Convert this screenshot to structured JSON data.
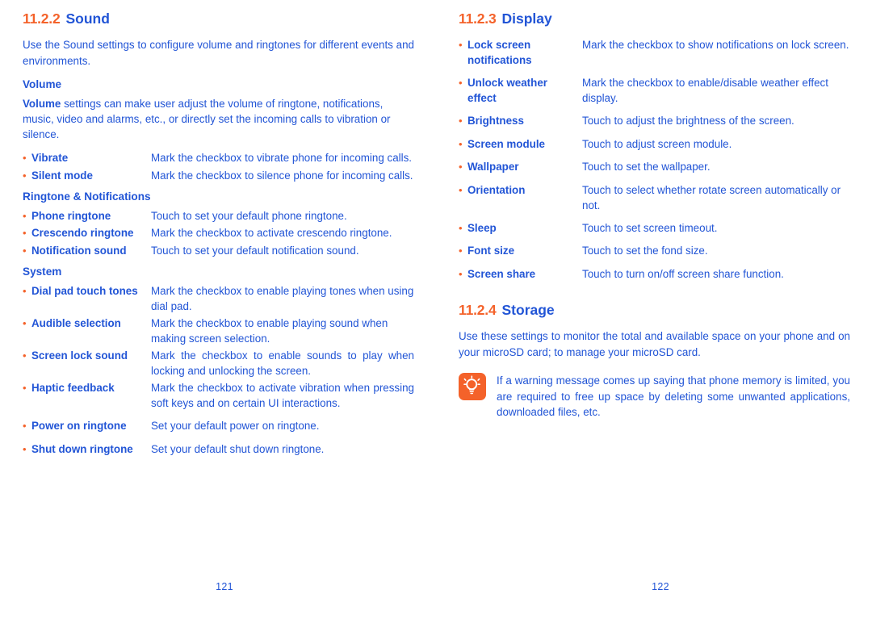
{
  "document": {
    "title": "Settings — Sound, Display, Storage"
  },
  "colors": {
    "accent_orange": "#f4622a",
    "text_blue": "#2255d6",
    "background": "#ffffff"
  },
  "left_page": {
    "page_number": "121",
    "section": {
      "number": "11.2.2",
      "title": "Sound",
      "intro": "Use the Sound settings to configure volume and ringtones for different events  and environments."
    },
    "groups": [
      {
        "heading": "Volume",
        "paragraph_lead": "Volume",
        "paragraph_rest": " settings can make user adjust the volume of ringtone, notifications, music, video and alarms, etc., or directly set the incoming calls to vibration or silence.",
        "items": [
          {
            "term": "Vibrate",
            "desc": "Mark the checkbox to vibrate phone for incoming calls."
          },
          {
            "term": "Silent mode",
            "desc": "Mark the checkbox to silence phone for incoming calls."
          }
        ]
      },
      {
        "heading": "Ringtone & Notifications",
        "items": [
          {
            "term": "Phone ringtone",
            "desc": "Touch to set your default phone ringtone."
          },
          {
            "term": "Crescendo ringtone",
            "desc": "Mark the checkbox to activate crescendo ringtone."
          },
          {
            "term": "Notification sound",
            "desc": "Touch to set your default notification sound."
          }
        ]
      },
      {
        "heading": "System",
        "items": [
          {
            "term": "Dial pad touch tones",
            "desc": "Mark the checkbox to enable playing tones when using dial pad."
          },
          {
            "term": "Audible selection",
            "desc": "Mark the checkbox to enable playing sound when making screen selection."
          },
          {
            "term": "Screen lock sound",
            "desc": "Mark the checkbox to enable sounds to play when locking and unlocking the screen."
          },
          {
            "term": "Haptic feedback",
            "desc": "Mark the checkbox to activate vibration when pressing soft keys and on certain UI interactions."
          },
          {
            "term": "Power on ringtone",
            "desc": "Set your default power on ringtone."
          },
          {
            "term": "Shut down ringtone",
            "desc": "Set your default shut down ringtone."
          }
        ]
      }
    ]
  },
  "right_page": {
    "page_number": "122",
    "display_section": {
      "number": "11.2.3",
      "title": "Display",
      "items": [
        {
          "term": "Lock screen notifications",
          "desc": "Mark the checkbox to show notifications on lock screen."
        },
        {
          "term": "Unlock weather effect",
          "desc": "Mark the checkbox to enable/disable weather effect display."
        },
        {
          "term": "Brightness",
          "desc": "Touch to adjust the brightness of the screen."
        },
        {
          "term": "Screen module",
          "desc": "Touch to adjust screen module."
        },
        {
          "term": "Wallpaper",
          "desc": "Touch to set the wallpaper."
        },
        {
          "term": "Orientation",
          "desc": "Touch to select whether rotate screen automatically or not."
        },
        {
          "term": "Sleep",
          "desc": "Touch to set screen timeout."
        },
        {
          "term": "Font size",
          "desc": "Touch to set the fond size."
        },
        {
          "term": "Screen share",
          "desc": "Touch to turn on/off screen share function."
        }
      ]
    },
    "storage_section": {
      "number": "11.2.4",
      "title": "Storage",
      "intro": "Use these settings to monitor the total and available space on your phone and on your microSD card; to manage your microSD card.",
      "tip": {
        "icon": "lightbulb-tip-icon",
        "text": "If a warning message comes up saying that phone memory is limited, you are required to free up space by deleting some unwanted applications, downloaded files, etc."
      }
    }
  },
  "bullet_glyph": "•"
}
